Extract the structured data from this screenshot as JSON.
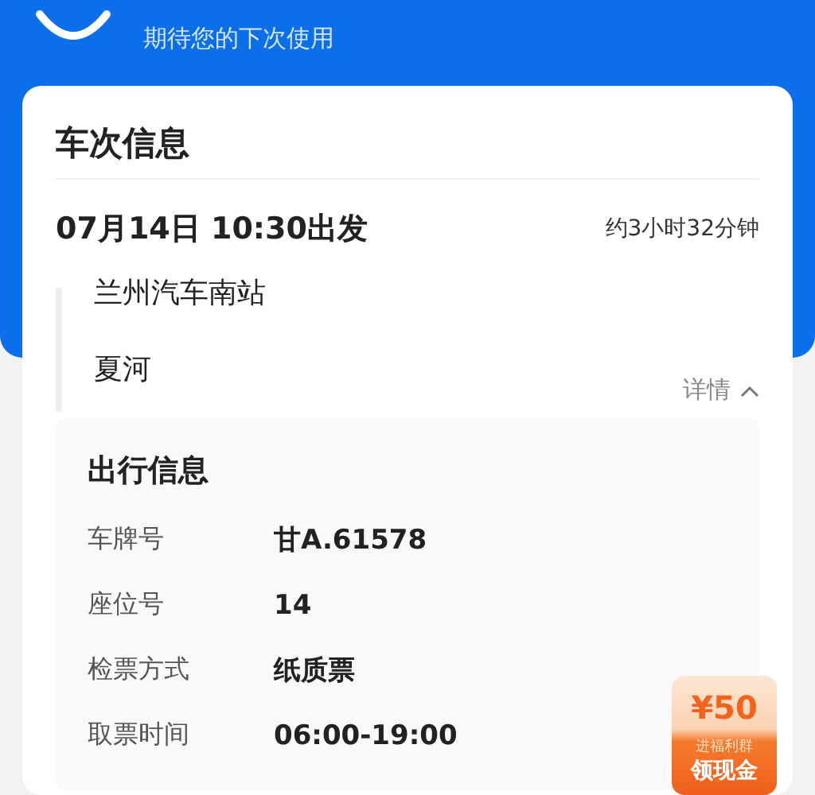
{
  "header": {
    "subtitle": "期待您的下次使用"
  },
  "trip": {
    "title": "车次信息",
    "departure": "07月14日 10:30出发",
    "duration": "约3小时32分钟",
    "stations": [
      "兰州汽车南站",
      "夏河"
    ],
    "details_toggle": {
      "label": "详情",
      "expanded": true
    }
  },
  "travel_info": {
    "title": "出行信息",
    "rows": [
      {
        "label": "车牌号",
        "value": "甘A.61578"
      },
      {
        "label": "座位号",
        "value": "14"
      },
      {
        "label": "检票方式",
        "value": "纸质票"
      },
      {
        "label": "取票时间",
        "value": "06:00-19:00"
      }
    ]
  },
  "coupon": {
    "amount": "¥50",
    "caption": "进福利群",
    "action": "领现金"
  }
}
